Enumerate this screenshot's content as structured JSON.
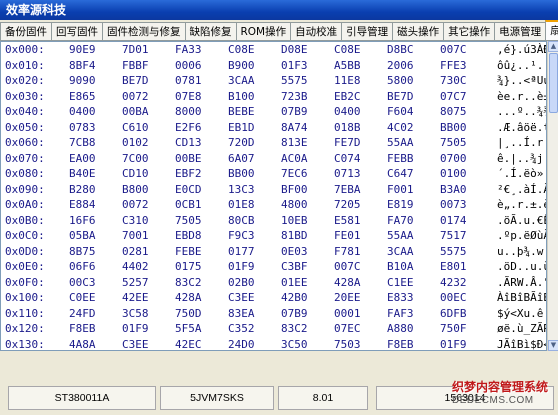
{
  "window": {
    "title": "效率源科技"
  },
  "tabs": [
    {
      "label": "备份固件",
      "active": false
    },
    {
      "label": "回写固件",
      "active": false
    },
    {
      "label": "固件检测与修复",
      "active": false
    },
    {
      "label": "缺陷修复",
      "active": false
    },
    {
      "label": "ROM操作",
      "active": false
    },
    {
      "label": "自动校准",
      "active": false
    },
    {
      "label": "引导管理",
      "active": false
    },
    {
      "label": "磁头操作",
      "active": false
    },
    {
      "label": "其它操作",
      "active": false
    },
    {
      "label": "电源管理",
      "active": false
    },
    {
      "label": "扇",
      "active": true
    }
  ],
  "hexview": {
    "rows": [
      {
        "addr": "0x000:",
        "hex": [
          "90E9",
          "7D01",
          "FA33",
          "C08E",
          "D08E",
          "C08E",
          "D8BC",
          "007C"
        ],
        "ascii": "‚é}.ú3À̂ÐÌÀ̂Ø¼.|"
      },
      {
        "addr": "0x010:",
        "hex": [
          "8BF4",
          "FBBF",
          "0006",
          "B900",
          "01F3",
          "A5BB",
          "2006",
          "FFE3"
        ],
        "ascii": "ôû¿..¹..ó¥» .ÿã"
      },
      {
        "addr": "0x020:",
        "hex": [
          "9090",
          "BE7D",
          "0781",
          "3CAA",
          "5575",
          "11E8",
          "5800",
          "730C"
        ],
        "ascii": "¾}..<ªUu.èX.s."
      },
      {
        "addr": "0x030:",
        "hex": [
          "E865",
          "0072",
          "07E8",
          "B100",
          "723B",
          "EB2C",
          "BE7D",
          "07C7"
        ],
        "ascii": "èe.r..è±.r;ë,¾}.Ç"
      },
      {
        "addr": "0x040:",
        "hex": [
          "0400",
          "00BA",
          "8000",
          "BEBE",
          "07B9",
          "0400",
          "F604",
          "8075"
        ],
        "ascii": "...º..¾¾.¹..ö..u"
      },
      {
        "addr": "0x050:",
        "hex": [
          "0783",
          "C610",
          "E2F6",
          "EB1D",
          "8A74",
          "018B",
          "4C02",
          "BB00"
        ],
        "ascii": ".Æ.âöë.t..L.»."
      },
      {
        "addr": "0x060:",
        "hex": [
          "7CB8",
          "0102",
          "CD13",
          "720D",
          "813E",
          "FE7D",
          "55AA",
          "7505"
        ],
        "ascii": "|¸..Í.r..>þ}Uªu."
      },
      {
        "addr": "0x070:",
        "hex": [
          "EA00",
          "7C00",
          "00BE",
          "6A07",
          "AC0A",
          "C074",
          "FEBB",
          "0700"
        ],
        "ascii": "ê.|..¾j.¬.Àtþ»."
      },
      {
        "addr": "0x080:",
        "hex": [
          "B40E",
          "CD10",
          "EBF2",
          "BB00",
          "7EC6",
          "0713",
          "C647",
          "0100"
        ],
        "ascii": "´.Í.ëò».~Æ..ÆG.."
      },
      {
        "addr": "0x090:",
        "hex": [
          "B280",
          "B800",
          "E0CD",
          "13C3",
          "BF00",
          "7EBA",
          "F001",
          "B3A0"
        ],
        "ascii": "²€¸.àÍ.Ã¿.~ºð.³ "
      },
      {
        "addr": "0x0A0:",
        "hex": [
          "E884",
          "0072",
          "0CB1",
          "01E8",
          "4800",
          "7205",
          "E819",
          "0073"
        ],
        "ascii": "è„.r.±.èH.r.è..s"
      },
      {
        "addr": "0x0B0:",
        "hex": [
          "16F6",
          "C310",
          "7505",
          "80CB",
          "10EB",
          "E581",
          "FA70",
          "0174"
        ],
        "ascii": ".öÃ.u.€Ë.ëåúp.t"
      },
      {
        "addr": "0x0C0:",
        "hex": [
          "05BA",
          "7001",
          "EBD8",
          "F9C3",
          "81BD",
          "FE01",
          "55AA",
          "7517"
        ],
        "ascii": ".ºp.ëØùÃ½þ.Uªu."
      },
      {
        "addr": "0x0D0:",
        "hex": [
          "8B75",
          "0281",
          "FEBE",
          "0177",
          "0E03",
          "F781",
          "3CAA",
          "5575"
        ],
        "ascii": "u..þ¾.w..÷<ªUu"
      },
      {
        "addr": "0x0E0:",
        "hex": [
          "06F6",
          "4402",
          "0175",
          "01F9",
          "C3BF",
          "007C",
          "B10A",
          "E801"
        ],
        "ascii": ".öD..u.ùÃ¿.|±.è."
      },
      {
        "addr": "0x0F0:",
        "hex": [
          "00C3",
          "5257",
          "83C2",
          "02B0",
          "01EE",
          "428A",
          "C1EE",
          "4232"
        ],
        "ascii": ".ÃRW.Â.°.îBÁîB2"
      },
      {
        "addr": "0x100:",
        "hex": [
          "C0EE",
          "42EE",
          "428A",
          "C3EE",
          "42B0",
          "20EE",
          "E833",
          "00EC"
        ],
        "ascii": "ÀîBîBÃîB° îè3.ì"
      },
      {
        "addr": "0x110:",
        "hex": [
          "24FD",
          "3C58",
          "750D",
          "83EA",
          "07B9",
          "0001",
          "FAF3",
          "6DFB"
        ],
        "ascii": "$ý<Xu.ê.¹..úóm"
      },
      {
        "addr": "0x120:",
        "hex": [
          "F8EB",
          "01F9",
          "5F5A",
          "C352",
          "83C2",
          "07EC",
          "A880",
          "750F"
        ],
        "ascii": "øë.ù_ZÃR.Â.ì¨€u."
      },
      {
        "addr": "0x130:",
        "hex": [
          "4A8A",
          "C3EE",
          "42EC",
          "24D0",
          "3C50",
          "7503",
          "F8EB",
          "01F9"
        ],
        "ascii": "JÃîBì$Ð<Pu.øë.ù"
      }
    ]
  },
  "status": {
    "model": "ST380011A",
    "serial": "5JVM7SKS",
    "firmware": "8.01",
    "capacity": "1563014"
  },
  "watermark": {
    "cn": "织梦内容管理系统",
    "en": "DEDECMS.COM"
  }
}
